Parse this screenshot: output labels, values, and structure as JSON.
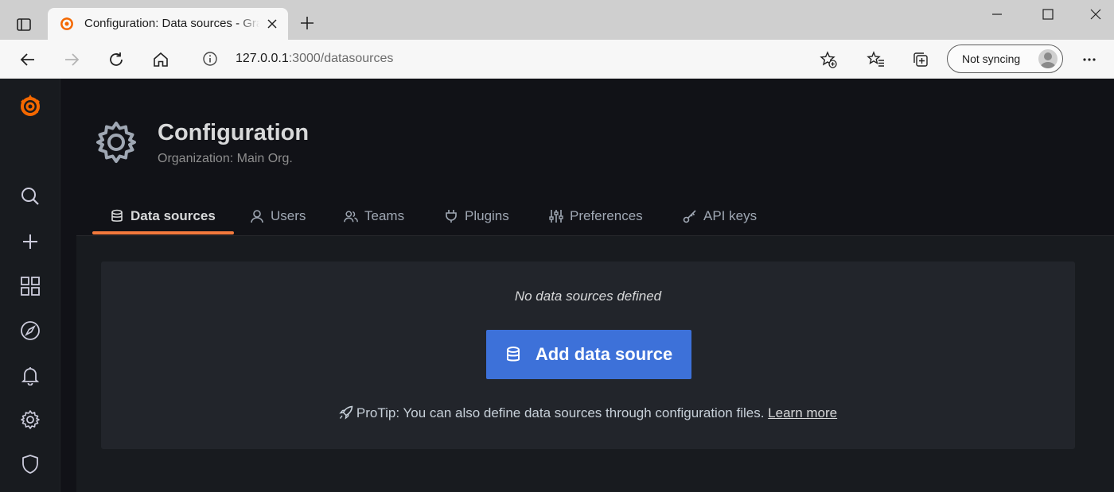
{
  "browser": {
    "tab_title": "Configuration: Data sources - Grafana",
    "url_host": "127.0.0.1",
    "url_rest": ":3000/datasources",
    "sync_label": "Not syncing",
    "icons": {
      "tab_actions": "tab-actions-icon",
      "favicon": "grafana-logo-icon",
      "close": "close-icon",
      "new_tab": "plus-icon",
      "back": "arrow-left-icon",
      "forward": "arrow-right-icon",
      "refresh": "refresh-icon",
      "home": "home-icon",
      "site_info": "info-icon",
      "add_favorite": "star-plus-icon",
      "favorites": "favorites-icon",
      "collections": "collections-icon",
      "more": "more-icon"
    }
  },
  "sidemenu": {
    "items": [
      {
        "name": "search",
        "icon": "search-icon"
      },
      {
        "name": "create",
        "icon": "plus-icon"
      },
      {
        "name": "dashboards",
        "icon": "apps-icon"
      },
      {
        "name": "explore",
        "icon": "compass-icon"
      },
      {
        "name": "alerting",
        "icon": "bell-icon"
      },
      {
        "name": "configuration",
        "icon": "cog-icon"
      },
      {
        "name": "server-admin",
        "icon": "shield-icon"
      }
    ]
  },
  "header": {
    "title": "Configuration",
    "subtitle": "Organization: Main Org."
  },
  "tabs": [
    {
      "label": "Data sources",
      "icon": "database-icon",
      "active": true
    },
    {
      "label": "Users",
      "icon": "user-icon",
      "active": false
    },
    {
      "label": "Teams",
      "icon": "users-icon",
      "active": false
    },
    {
      "label": "Plugins",
      "icon": "plug-icon",
      "active": false
    },
    {
      "label": "Preferences",
      "icon": "sliders-icon",
      "active": false
    },
    {
      "label": "API keys",
      "icon": "key-icon",
      "active": false
    }
  ],
  "empty_state": {
    "title": "No data sources defined",
    "button_label": "Add data source",
    "protip_text": "ProTip: You can also define data sources through configuration files.",
    "learn_more": "Learn more"
  },
  "colors": {
    "accent_orange": "#f3793c",
    "primary_button": "#3d71d9",
    "background": "#111217",
    "panel": "#22252b"
  }
}
